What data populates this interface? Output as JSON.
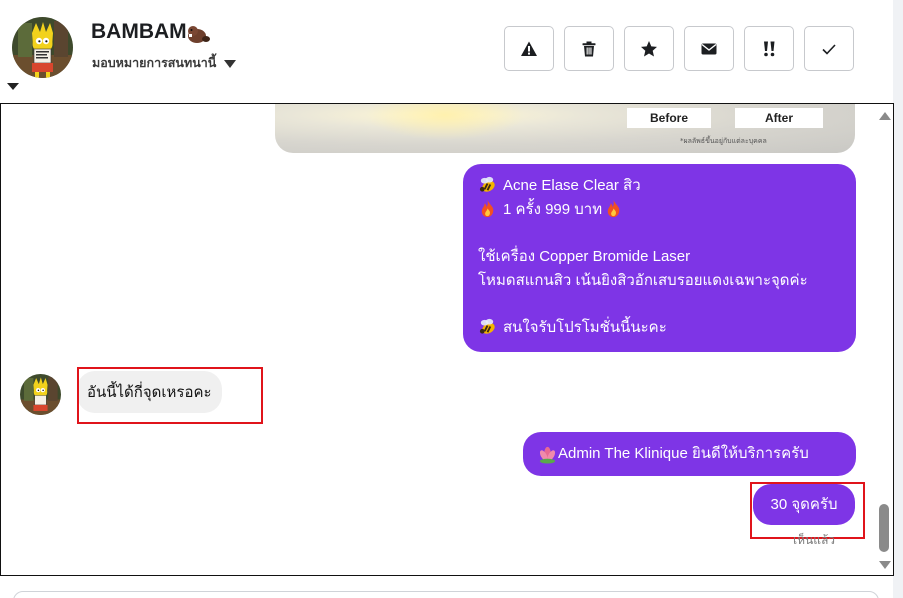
{
  "contact": {
    "name": "BAMBAM",
    "name_emoji": "beaver-emoji",
    "assign_label": "มอบหมายการสนทนานี้",
    "avatar": "cartoon-avatar"
  },
  "actions": [
    {
      "icon": "warning-icon",
      "label": "Report"
    },
    {
      "icon": "trash-icon",
      "label": "Delete"
    },
    {
      "icon": "star-icon",
      "label": "Star"
    },
    {
      "icon": "envelope-icon",
      "label": "Mark unread"
    },
    {
      "icon": "double-exclaim-icon",
      "label": "Important"
    },
    {
      "icon": "check-icon",
      "label": "Done"
    }
  ],
  "messages": {
    "promo_image": {
      "before": "Before",
      "after": "After",
      "note": "*ผลลัพธ์ขึ้นอยู่กับแต่ละบุคคล"
    },
    "promo": {
      "line1": "Acne Elase Clear สิว",
      "line2": "1 ครั้ง 999 บาท",
      "line3": "ใช้เครื่อง Copper Bromide Laser",
      "line4": "โหมดสแกนสิว เน้นยิงสิวอักเสบรอยแดงเฉพาะจุดค่ะ",
      "line5": "สนใจรับโปรโมชั่นนี้นะคะ"
    },
    "incoming": "อันนี้ได้กี่จุดเหรอคะ",
    "welcome": "Admin The Klinique ยินดีให้บริการครับ",
    "reply": "30 จุดครับ",
    "seen": "เห็นแล้ว"
  },
  "colors": {
    "outgoing_bubble": "#7e35e6",
    "incoming_bubble": "#f0f0f0",
    "highlight": "#e0141b"
  }
}
